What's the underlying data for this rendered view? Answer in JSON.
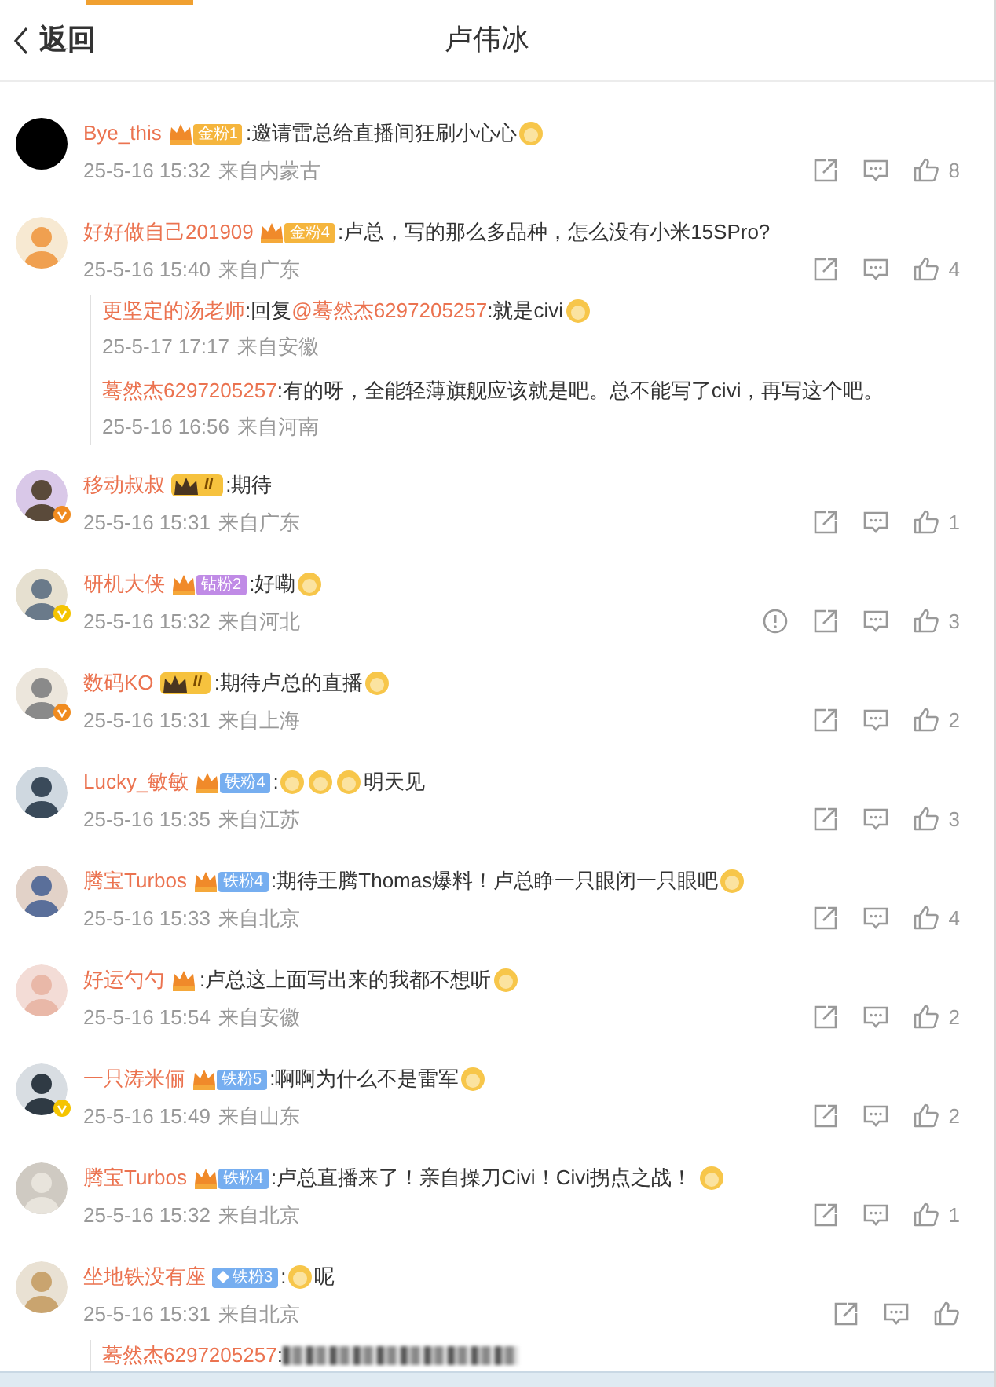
{
  "header": {
    "back": "返回",
    "title": "卢伟冰"
  },
  "comments": [
    {
      "name": "Bye_this",
      "avatar": {
        "kind": "plain"
      },
      "badge": {
        "kind": "gold",
        "text": "金粉1"
      },
      "content": [
        {
          "kind": "text",
          "text": ":邀请雷总给直播间狂刷小心心"
        },
        {
          "kind": "emoji"
        }
      ],
      "date": "25-5-16 15:32",
      "place": "来自内蒙古",
      "report": false,
      "likes": "8"
    },
    {
      "name": "好好做自己201909",
      "avatar": {
        "kind": "picture"
      },
      "badge": {
        "kind": "gold",
        "text": "金粉4"
      },
      "content": [
        {
          "kind": "text",
          "text": ":卢总，写的那么多品种，怎么没有小米15SPro?"
        }
      ],
      "date": "25-5-16 15:40",
      "place": "来自广东",
      "report": false,
      "likes": "4",
      "replies": [
        {
          "name": "更坚定的汤老师",
          "content": [
            {
              "kind": "text",
              "text": ":回复"
            },
            {
              "kind": "mention",
              "text": "@蓦然杰6297205257"
            },
            {
              "kind": "text",
              "text": ":就是civi"
            },
            {
              "kind": "emoji"
            }
          ],
          "date": "25-5-17 17:17",
          "place": "来自安徽"
        },
        {
          "name": "蓦然杰6297205257",
          "content": [
            {
              "kind": "text",
              "text": ":有的呀，全能轻薄旗舰应该就是吧。总不能写了civi，再写这个吧。"
            }
          ],
          "date": "25-5-16 16:56",
          "place": "来自河南"
        }
      ]
    },
    {
      "name": "移动叔叔",
      "avatar": {
        "kind": "picture"
      },
      "verified": {
        "color": "#f08b1f"
      },
      "badge": {
        "kind": "crown",
        "text": "II"
      },
      "content": [
        {
          "kind": "text",
          "text": ":期待"
        }
      ],
      "date": "25-5-16 15:31",
      "place": "来自广东",
      "report": false,
      "likes": "1"
    },
    {
      "name": "研机大侠",
      "avatar": {
        "kind": "picture"
      },
      "verified": {
        "color": "#f5c400"
      },
      "badge": {
        "kind": "diamond",
        "text": "钻粉2"
      },
      "content": [
        {
          "kind": "text",
          "text": ":好嘞"
        },
        {
          "kind": "emoji"
        }
      ],
      "date": "25-5-16 15:32",
      "place": "来自河北",
      "report": true,
      "likes": "3"
    },
    {
      "name": "数码KO",
      "avatar": {
        "kind": "picture"
      },
      "verified": {
        "color": "#f08b1f"
      },
      "badge": {
        "kind": "crown",
        "text": "II"
      },
      "content": [
        {
          "kind": "text",
          "text": ":期待卢总的直播"
        },
        {
          "kind": "emoji"
        }
      ],
      "date": "25-5-16 15:31",
      "place": "来自上海",
      "report": false,
      "likes": "2"
    },
    {
      "name": "Lucky_敏敏",
      "avatar": {
        "kind": "picture"
      },
      "badge": {
        "kind": "iron",
        "text": "铁粉4"
      },
      "content": [
        {
          "kind": "text",
          "text": ":"
        },
        {
          "kind": "emoji"
        },
        {
          "kind": "emoji"
        },
        {
          "kind": "emoji"
        },
        {
          "kind": "text",
          "text": "明天见"
        }
      ],
      "date": "25-5-16 15:35",
      "place": "来自江苏",
      "report": false,
      "likes": "3"
    },
    {
      "name": "腾宝Turbos",
      "avatar": {
        "kind": "picture"
      },
      "badge": {
        "kind": "iron",
        "text": "铁粉4"
      },
      "content": [
        {
          "kind": "text",
          "text": ":期待王腾Thomas爆料！卢总睁一只眼闭一只眼吧"
        },
        {
          "kind": "emoji"
        }
      ],
      "date": "25-5-16 15:33",
      "place": "来自北京",
      "report": false,
      "likes": "4"
    },
    {
      "name": "好运勺勺",
      "avatar": {
        "kind": "picture"
      },
      "badge": {
        "kind": "icon"
      },
      "content": [
        {
          "kind": "text",
          "text": ":卢总这上面写出来的我都不想听"
        },
        {
          "kind": "emoji"
        }
      ],
      "date": "25-5-16 15:54",
      "place": "来自安徽",
      "report": false,
      "likes": "2"
    },
    {
      "name": "一只涛米俪",
      "avatar": {
        "kind": "picture"
      },
      "verified": {
        "color": "#f5c400"
      },
      "badge": {
        "kind": "iron",
        "text": "铁粉5"
      },
      "content": [
        {
          "kind": "text",
          "text": ":啊啊为什么不是雷军"
        },
        {
          "kind": "emoji"
        }
      ],
      "date": "25-5-16 15:49",
      "place": "来自山东",
      "report": false,
      "likes": "2"
    },
    {
      "name": "腾宝Turbos",
      "avatar": {
        "kind": "picture"
      },
      "badge": {
        "kind": "iron",
        "text": "铁粉4"
      },
      "content": [
        {
          "kind": "text",
          "text": ":卢总直播来了！亲自操刀Civi！Civi拐点之战！ "
        },
        {
          "kind": "emoji"
        }
      ],
      "date": "25-5-16 15:32",
      "place": "来自北京",
      "report": false,
      "likes": "1"
    },
    {
      "name": "坐地铁没有座",
      "avatar": {
        "kind": "picture"
      },
      "badge": {
        "kind": "iron_plus",
        "text": "铁粉3"
      },
      "content": [
        {
          "kind": "text",
          "text": ":"
        },
        {
          "kind": "emoji"
        },
        {
          "kind": "text",
          "text": "呢"
        }
      ],
      "date": "25-5-16 15:31",
      "place": "来自北京",
      "report": false,
      "replies": [
        {
          "name": "蓦然杰6297205257",
          "content": [
            {
              "kind": "text",
              "text": ":"
            },
            {
              "kind": "blurred"
            }
          ]
        }
      ]
    }
  ]
}
